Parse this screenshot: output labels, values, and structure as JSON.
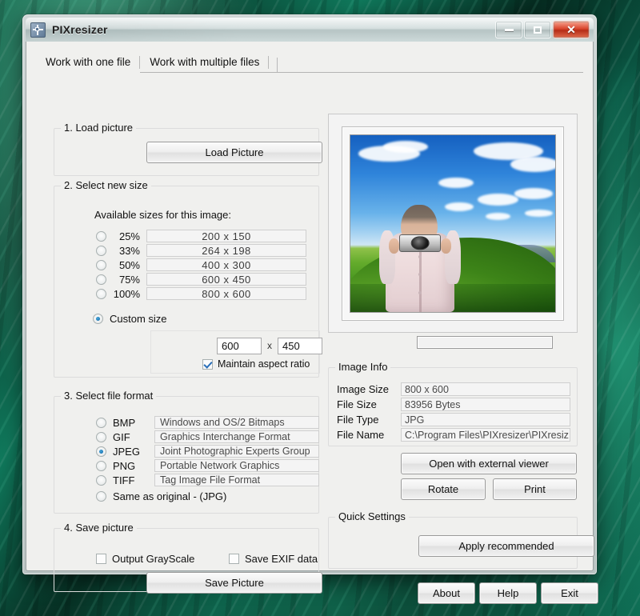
{
  "window": {
    "title": "PIXresizer",
    "icon": "resize-app-icon",
    "minimize_label": "Minimize",
    "maximize_label": "Maximize",
    "close_label": "Close"
  },
  "tabs": [
    {
      "label": "Work with one file",
      "active": true
    },
    {
      "label": "Work with multiple files",
      "active": false
    }
  ],
  "load_section": {
    "legend": "1. Load picture",
    "load_button": "Load Picture"
  },
  "size_section": {
    "legend": "2. Select new size",
    "available_label": "Available sizes for this image:",
    "presets": [
      {
        "percent": "25%",
        "size": "200 x 150",
        "selected": false
      },
      {
        "percent": "33%",
        "size": "264 x 198",
        "selected": false
      },
      {
        "percent": "50%",
        "size": "400 x 300",
        "selected": false
      },
      {
        "percent": "75%",
        "size": "600 x 450",
        "selected": false
      },
      {
        "percent": "100%",
        "size": "800 x 600",
        "selected": false
      }
    ],
    "custom_label": "Custom size",
    "custom_selected": true,
    "width_value": "600",
    "separator": "x",
    "height_value": "450",
    "aspect_label": "Maintain aspect ratio",
    "aspect_checked": true
  },
  "format_section": {
    "legend": "3. Select file format",
    "formats": [
      {
        "name": "BMP",
        "description": "Windows and OS/2 Bitmaps",
        "selected": false
      },
      {
        "name": "GIF",
        "description": "Graphics Interchange Format",
        "selected": false
      },
      {
        "name": "JPEG",
        "description": "Joint Photographic Experts Group",
        "selected": true
      },
      {
        "name": "PNG",
        "description": "Portable Network Graphics",
        "selected": false
      },
      {
        "name": "TIFF",
        "description": "Tag Image File Format",
        "selected": false
      }
    ],
    "same_as_original": "Same as original  - (JPG)",
    "same_selected": false
  },
  "save_section": {
    "legend": "4. Save picture",
    "grayscale_label": "Output GrayScale",
    "grayscale_checked": false,
    "exif_label": "Save EXIF data",
    "exif_checked": false,
    "save_button": "Save Picture"
  },
  "info_section": {
    "legend": "Image Info",
    "rows": [
      {
        "key": "Image Size",
        "value": "800 x 600"
      },
      {
        "key": "File Size",
        "value": "83956 Bytes"
      },
      {
        "key": "File Type",
        "value": "JPG"
      },
      {
        "key": "File Name",
        "value": "C:\\Program Files\\PIXresizer\\PIXresiz"
      }
    ],
    "open_external_button": "Open with external viewer",
    "rotate_button": "Rotate",
    "print_button": "Print"
  },
  "quick_section": {
    "legend": "Quick Settings",
    "apply_button": "Apply recommended"
  },
  "footer": {
    "about_button": "About",
    "help_button": "Help",
    "exit_button": "Exit"
  },
  "colors": {
    "accent_blue": "#0a62a8",
    "close_red": "#d9452c",
    "window_face": "#f0f0ee",
    "desktop_green": "#0d5c44"
  }
}
